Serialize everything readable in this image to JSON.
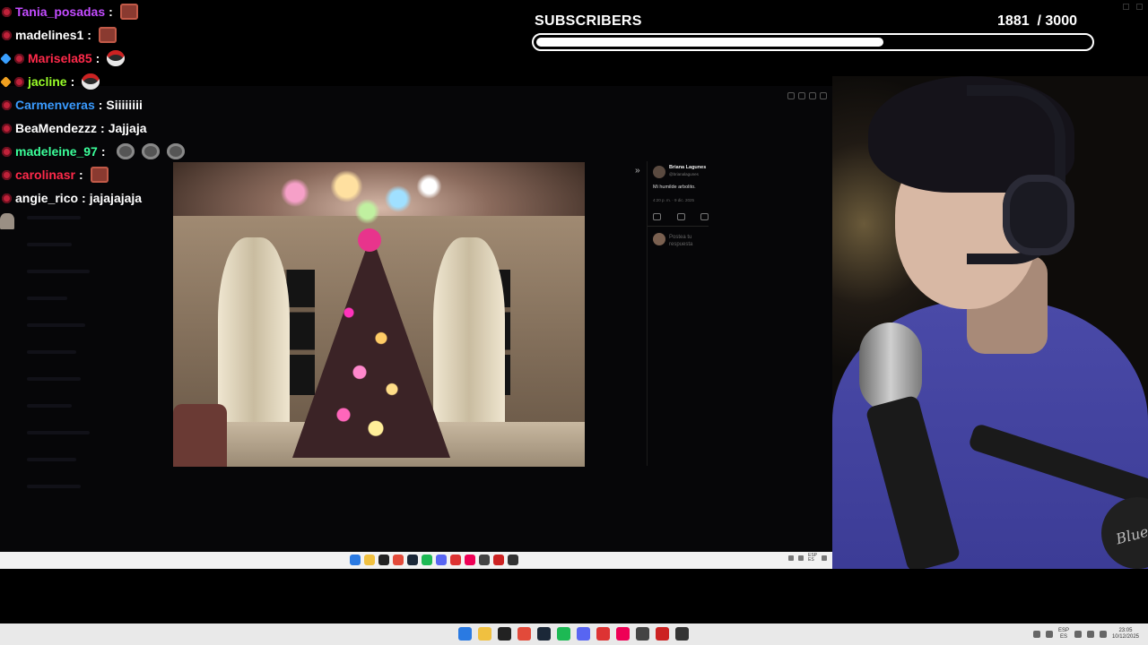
{
  "chat": {
    "messages": [
      {
        "user": "Tania_posadas",
        "color": "#c34cff",
        "badges": [
          "devil"
        ],
        "text": "",
        "emotes": [
          "red"
        ]
      },
      {
        "user": "madelines1",
        "color": "#ffffff",
        "badges": [
          "devil"
        ],
        "text": "",
        "emotes": [
          "red"
        ]
      },
      {
        "user": "Marisela85",
        "color": "#ff2a4a",
        "badges": [
          "cube",
          "devil"
        ],
        "text": "",
        "emotes": [
          "santa"
        ]
      },
      {
        "user": "jacline",
        "color": "#9aff2a",
        "badges": [
          "gold",
          "devil"
        ],
        "text": "",
        "emotes": [
          "santa"
        ]
      },
      {
        "user": "Carmenveras",
        "color": "#3a9bff",
        "badges": [
          "devil"
        ],
        "text": "Siiiiiiii",
        "emotes": []
      },
      {
        "user": "BeaMendezzz",
        "color": "#ffffff",
        "badges": [
          "devil"
        ],
        "text": "Jajjaja",
        "emotes": []
      },
      {
        "user": "madeleine_97",
        "color": "#3bff9a",
        "badges": [
          "devil"
        ],
        "text": "",
        "emotes": [
          "grey",
          "grey",
          "grey"
        ]
      },
      {
        "user": "carolinasr",
        "color": "#ff2a4a",
        "badges": [
          "devil"
        ],
        "text": "",
        "emotes": [
          "red"
        ]
      },
      {
        "user": "angie_rico",
        "color": "#ffffff",
        "badges": [
          "devil"
        ],
        "text": "jajajajaja",
        "emotes": []
      }
    ]
  },
  "subscribers": {
    "title": "SUBSCRIBERS",
    "current": "1881",
    "goal": "/ 3000",
    "progress": 0.627
  },
  "tweet": {
    "author": "Briana Lagunes",
    "handle": "@brianalagunes",
    "text": "Mi humilde arbolito.",
    "time": "4:20 p. m. · 9 dic. 2025",
    "reply_placeholder": "Postea tu respuesta"
  },
  "photo": {
    "subject": "pink-christmas-tree"
  },
  "webcam": {
    "mic_brand": "Blue"
  },
  "taskbar": {
    "icons": [
      "windows-start-icon",
      "file-explorer-icon",
      "terminal-icon",
      "chrome-icon",
      "steam-icon",
      "spotify-icon",
      "discord-icon",
      "app-red-icon",
      "app-blue-icon",
      "app-grey-icon",
      "app-store-icon",
      "settings-icon"
    ],
    "lang": "ESP",
    "region": "ES",
    "time": "23:05",
    "date": "10/12/2025"
  },
  "colors": {
    "accent": "#ffffff",
    "hoodie": "#4a4aa8"
  }
}
